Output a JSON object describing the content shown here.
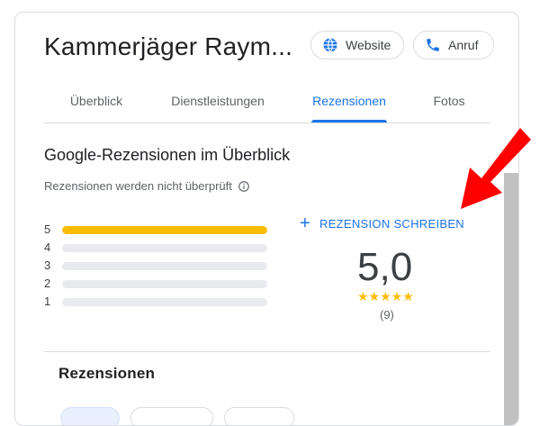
{
  "header": {
    "title": "Kammerjäger Raym...",
    "website_label": "Website",
    "call_label": "Anruf"
  },
  "tabs": [
    {
      "label": "Überblick"
    },
    {
      "label": "Dienstleistungen"
    },
    {
      "label": "Rezensionen"
    },
    {
      "label": "Fotos"
    }
  ],
  "active_tab": "Rezensionen",
  "summary": {
    "heading": "Google-Rezensionen im Überblick",
    "notice": "Rezensionen werden nicht überprüft",
    "write_label": "REZENSION SCHREIBEN",
    "score": "5,0",
    "stars": "★★★★★",
    "count": "(9)",
    "rating_rows": [
      {
        "stars": "5",
        "share": 1.0
      },
      {
        "stars": "4",
        "share": 0.0
      },
      {
        "stars": "3",
        "share": 0.0
      },
      {
        "stars": "2",
        "share": 0.0
      },
      {
        "stars": "1",
        "share": 0.0
      }
    ]
  },
  "reviews": {
    "heading": "Rezensionen"
  },
  "colors": {
    "accent": "#1a73e8",
    "star": "#fbbc04",
    "annotation_arrow": "#ff0000"
  }
}
